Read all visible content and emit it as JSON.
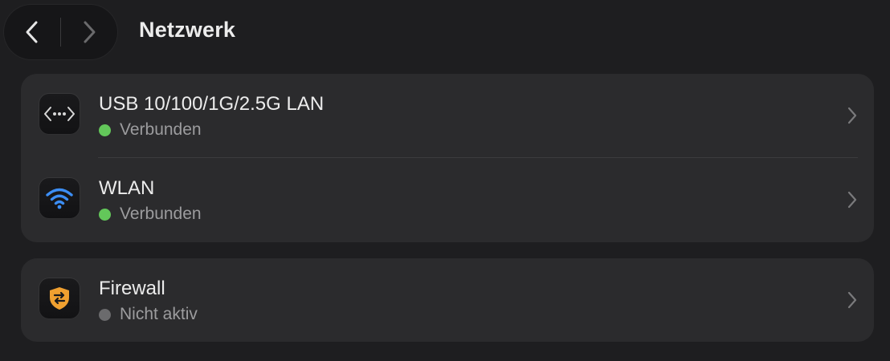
{
  "header": {
    "title": "Netzwerk"
  },
  "colors": {
    "status_connected": "#63c75a",
    "status_inactive": "#6b6b6d",
    "wifi_accent": "#3c8ef5",
    "firewall_accent": "#f0a030"
  },
  "services": [
    {
      "icon": "ethernet-icon",
      "title": "USB 10/100/1G/2.5G LAN",
      "status": "Verbunden"
    },
    {
      "icon": "wifi-icon",
      "title": "WLAN",
      "status": "Verbunden"
    }
  ],
  "security": [
    {
      "icon": "firewall-shield-icon",
      "title": "Firewall",
      "status": "Nicht aktiv"
    }
  ]
}
